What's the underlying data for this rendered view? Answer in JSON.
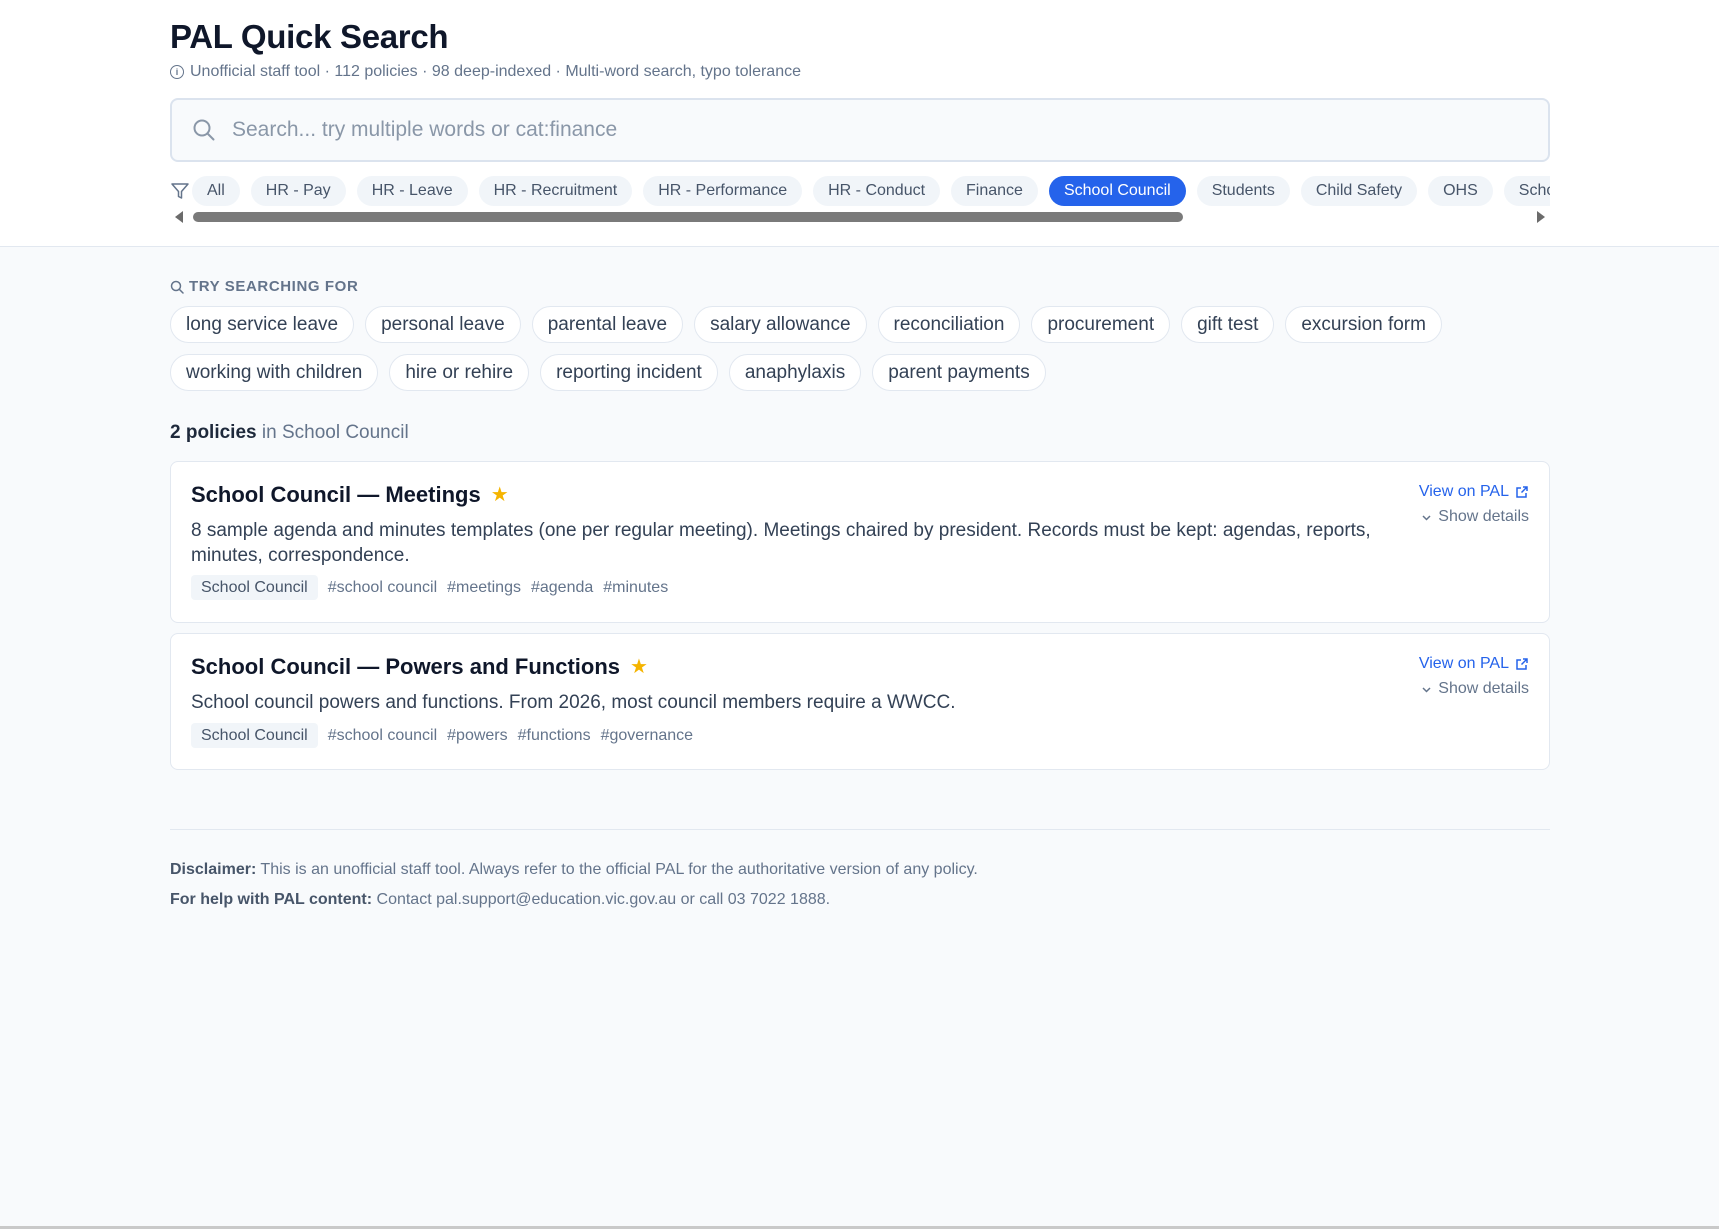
{
  "header": {
    "title": "PAL Quick Search",
    "subtitle": "Unofficial staff tool · 112 policies · 98 deep-indexed · Multi-word search, typo tolerance"
  },
  "search": {
    "placeholder": "Search... try multiple words or cat:finance",
    "value": ""
  },
  "filters": {
    "active": "School Council",
    "items": [
      "All",
      "HR - Pay",
      "HR - Leave",
      "HR - Recruitment",
      "HR - Performance",
      "HR - Conduct",
      "Finance",
      "School Council",
      "Students",
      "Child Safety",
      "OHS",
      "School"
    ]
  },
  "suggestions": {
    "label": "TRY SEARCHING FOR",
    "items": [
      "long service leave",
      "personal leave",
      "parental leave",
      "salary allowance",
      "reconciliation",
      "procurement",
      "gift test",
      "excursion form",
      "working with children",
      "hire or rehire",
      "reporting incident",
      "anaphylaxis",
      "parent payments"
    ]
  },
  "results": {
    "count": "2 policies",
    "context": " in School Council",
    "items": [
      {
        "title": "School Council — Meetings",
        "description": "8 sample agenda and minutes templates (one per regular meeting). Meetings chaired by president. Records must be kept: agendas, reports, minutes, correspondence.",
        "category": "School Council",
        "tags": [
          "#school council",
          "#meetings",
          "#agenda",
          "#minutes"
        ],
        "view_label": "View on PAL",
        "details_label": "Show details"
      },
      {
        "title": "School Council — Powers and Functions",
        "description": "School council powers and functions. From 2026, most council members require a WWCC.",
        "category": "School Council",
        "tags": [
          "#school council",
          "#powers",
          "#functions",
          "#governance"
        ],
        "view_label": "View on PAL",
        "details_label": "Show details"
      }
    ]
  },
  "footer": {
    "disclaimer_label": "Disclaimer:",
    "disclaimer_text": " This is an unofficial staff tool. Always refer to the official PAL for the authoritative version of any policy.",
    "help_label": "For help with PAL content:",
    "help_text": " Contact pal.support@education.vic.gov.au or call 03 7022 1888."
  },
  "colors": {
    "accent": "#2563eb",
    "star": "#f5b400",
    "background": "#f8fafc"
  }
}
